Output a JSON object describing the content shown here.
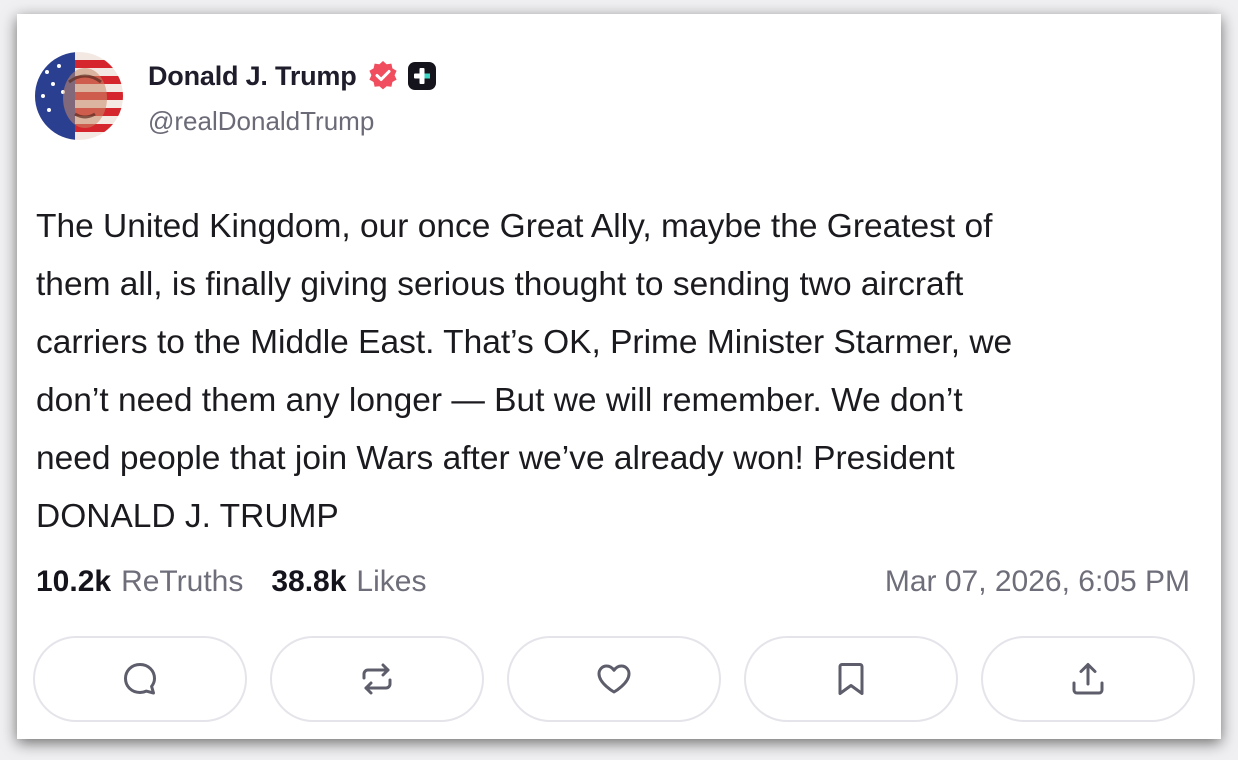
{
  "author": {
    "display_name": "Donald J. Trump",
    "handle": "@realDonaldTrump",
    "verified_icon": "verified-badge-icon",
    "plus_icon": "plus-badge-icon"
  },
  "post": {
    "text": "The United Kingdom, our once Great Ally, maybe the Greatest of\nthem all, is finally giving serious thought to sending two aircraft\ncarriers to the Middle East. That’s OK, Prime Minister Starmer, we\ndon’t need them any longer — But we will remember. We don’t\nneed people that join Wars after we’ve already won! President\nDONALD J. TRUMP"
  },
  "stats": {
    "retruths_count": "10.2k",
    "retruths_label": "ReTruths",
    "likes_count": "38.8k",
    "likes_label": "Likes",
    "timestamp": "Mar 07, 2026, 6:05 PM"
  },
  "actions": [
    {
      "icon": "comment-icon"
    },
    {
      "icon": "retruth-icon"
    },
    {
      "icon": "heart-icon"
    },
    {
      "icon": "bookmark-icon"
    },
    {
      "icon": "share-icon"
    }
  ],
  "colors": {
    "verified": "#f04e5f",
    "name": "#1f1d2b",
    "muted": "#6e6e7a",
    "icon_stroke": "#5d5d6b",
    "button_border": "#e4e4ea"
  }
}
